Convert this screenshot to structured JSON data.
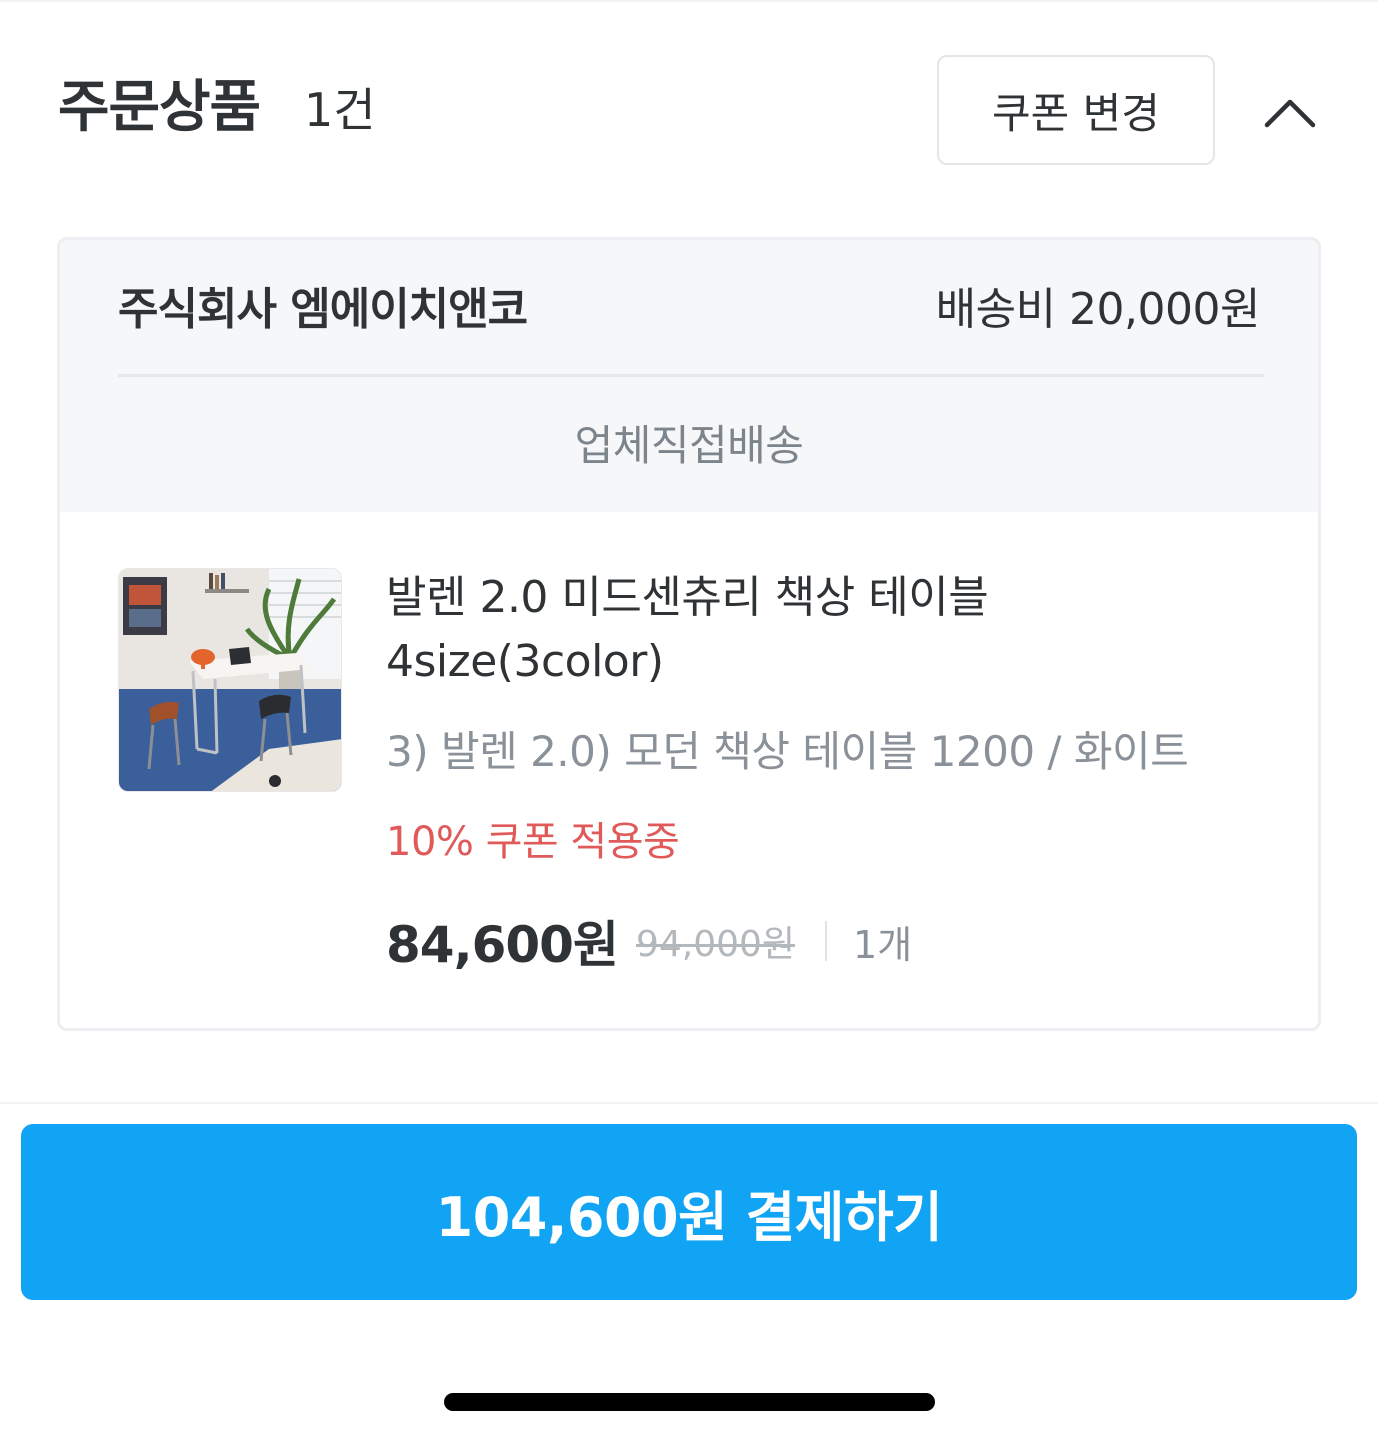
{
  "header": {
    "title": "주문상품",
    "count": "1건",
    "coupon_button": "쿠폰 변경",
    "collapse_icon": "chevron-up-icon"
  },
  "order": {
    "seller": "주식회사 엠에이치앤코",
    "shipping_fee": "배송비 20,000원",
    "shipping_method": "업체직접배송",
    "product": {
      "name": "발렌 2.0 미드센츄리 책상 테이블 4size(3color)",
      "option": "3) 발렌 2.0) 모던 책상 테이블 1200 / 화이트",
      "coupon_status": "10% 쿠폰 적용중",
      "sale_price": "84,600원",
      "original_price": "94,000원",
      "quantity": "1개"
    }
  },
  "checkout": {
    "pay_button": "104,600원 결제하기"
  },
  "colors": {
    "accent": "#12a4f4",
    "coupon_red": "#e05a5a",
    "text_primary": "#2f3336",
    "text_secondary": "#8a9198",
    "card_header_bg": "#f6f7f9"
  }
}
